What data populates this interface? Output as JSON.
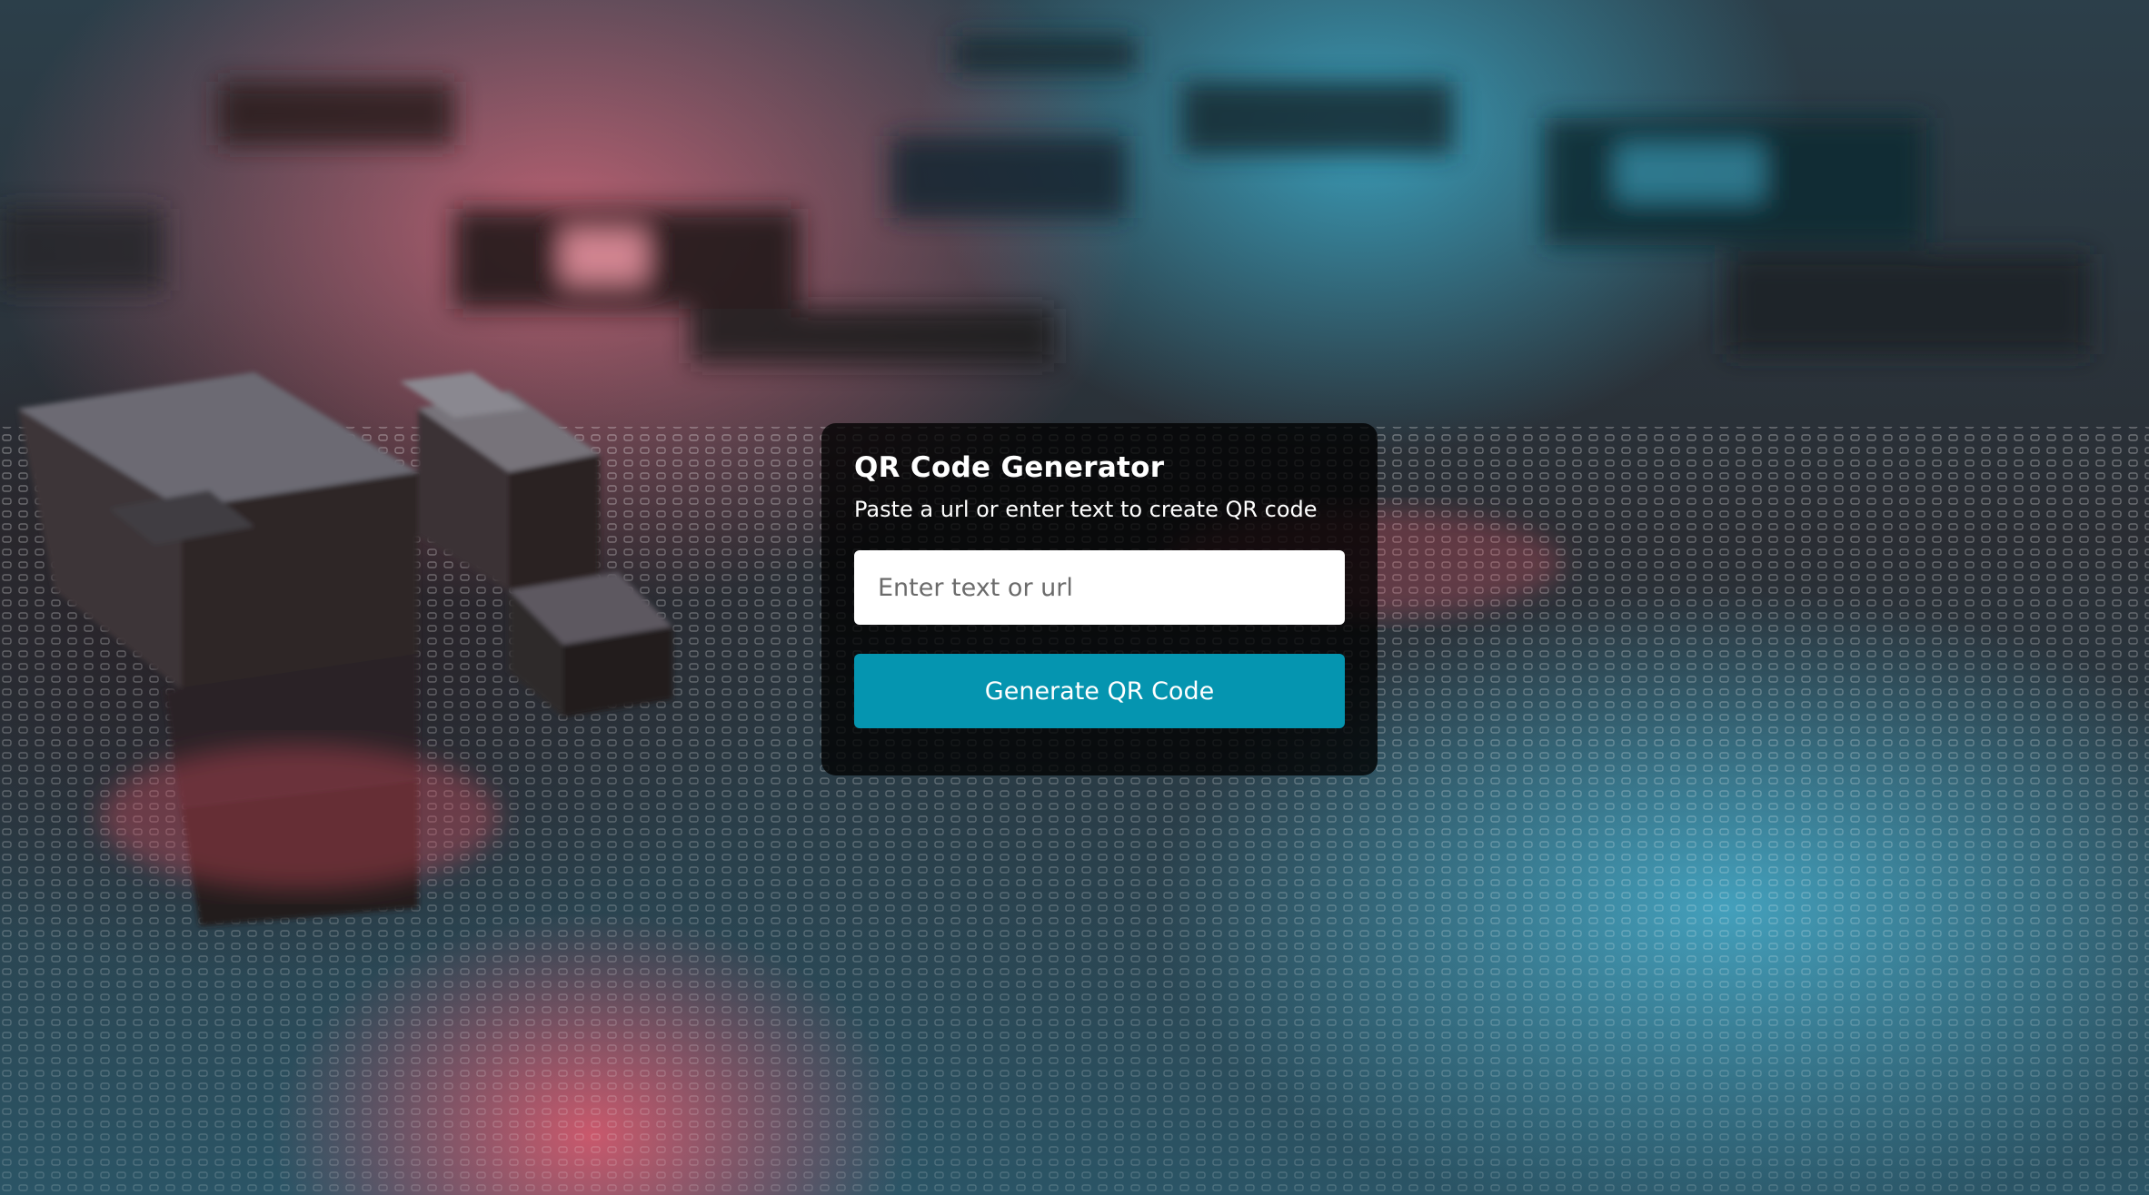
{
  "card": {
    "title": "QR Code Generator",
    "subtitle": "Paste a url or enter text to create QR code",
    "input": {
      "placeholder": "Enter text or url",
      "value": ""
    },
    "button_label": "Generate QR Code"
  },
  "colors": {
    "button_accent": "#0595b0",
    "card_background": "#000000",
    "input_background": "#ffffff"
  }
}
